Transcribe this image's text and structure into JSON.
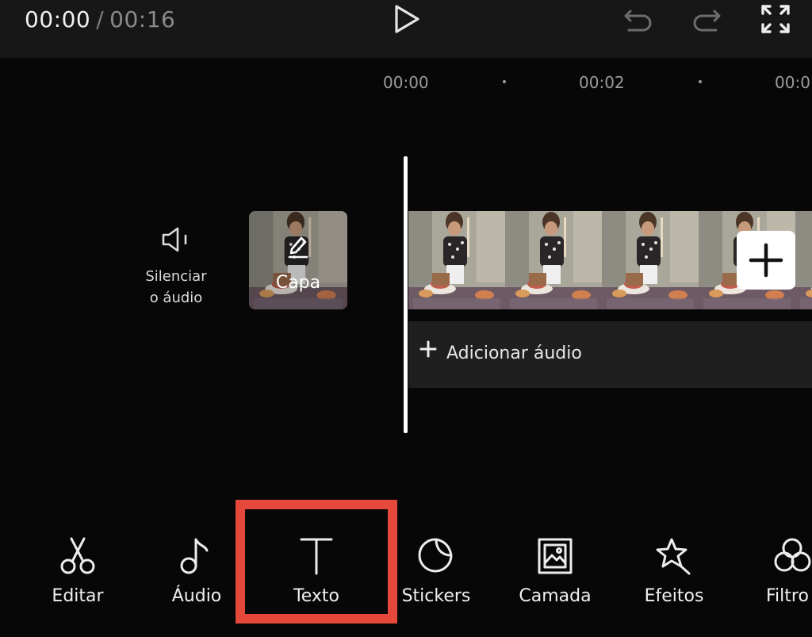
{
  "header": {
    "current_time": "00:00",
    "separator": "/",
    "duration": "00:16",
    "icons": [
      "play-icon",
      "undo-icon",
      "redo-icon",
      "fullscreen-icon"
    ]
  },
  "ruler": {
    "labels": [
      "00:00",
      "00:02",
      "00:0"
    ]
  },
  "timeline": {
    "mute": {
      "line1": "Silenciar",
      "line2": "o áudio"
    },
    "cover": {
      "label": "Capa"
    },
    "add_audio": "Adicionar áudio"
  },
  "toolbar": {
    "items": [
      {
        "label": "Editar",
        "icon": "scissors-icon"
      },
      {
        "label": "Áudio",
        "icon": "music-note-icon"
      },
      {
        "label": "Texto",
        "icon": "text-icon"
      },
      {
        "label": "Stickers",
        "icon": "sticker-icon"
      },
      {
        "label": "Camada",
        "icon": "overlay-icon"
      },
      {
        "label": "Efeitos",
        "icon": "star-effects-icon"
      },
      {
        "label": "Filtro",
        "icon": "filter-icon"
      }
    ]
  },
  "colors": {
    "highlight": "#e5493c",
    "background": "#070707",
    "topbar": "#171717"
  }
}
